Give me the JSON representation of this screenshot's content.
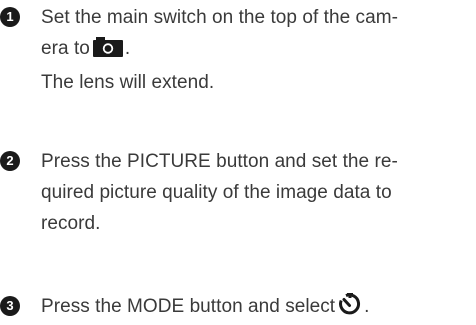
{
  "steps": [
    {
      "number": "1",
      "line1": "Set the main switch on the top of the cam-",
      "line2_pre": "era to",
      "line2_icon": "camera-icon",
      "line2_post": ".",
      "note": "The lens will extend."
    },
    {
      "number": "2",
      "line1": "Press the PICTURE button and set the re-",
      "line2": "quired picture quality of the image data to",
      "line3": "record."
    },
    {
      "number": "3",
      "text_pre": "Press the MODE button and select",
      "text_icon": "self-timer-icon",
      "text_post": "."
    }
  ]
}
